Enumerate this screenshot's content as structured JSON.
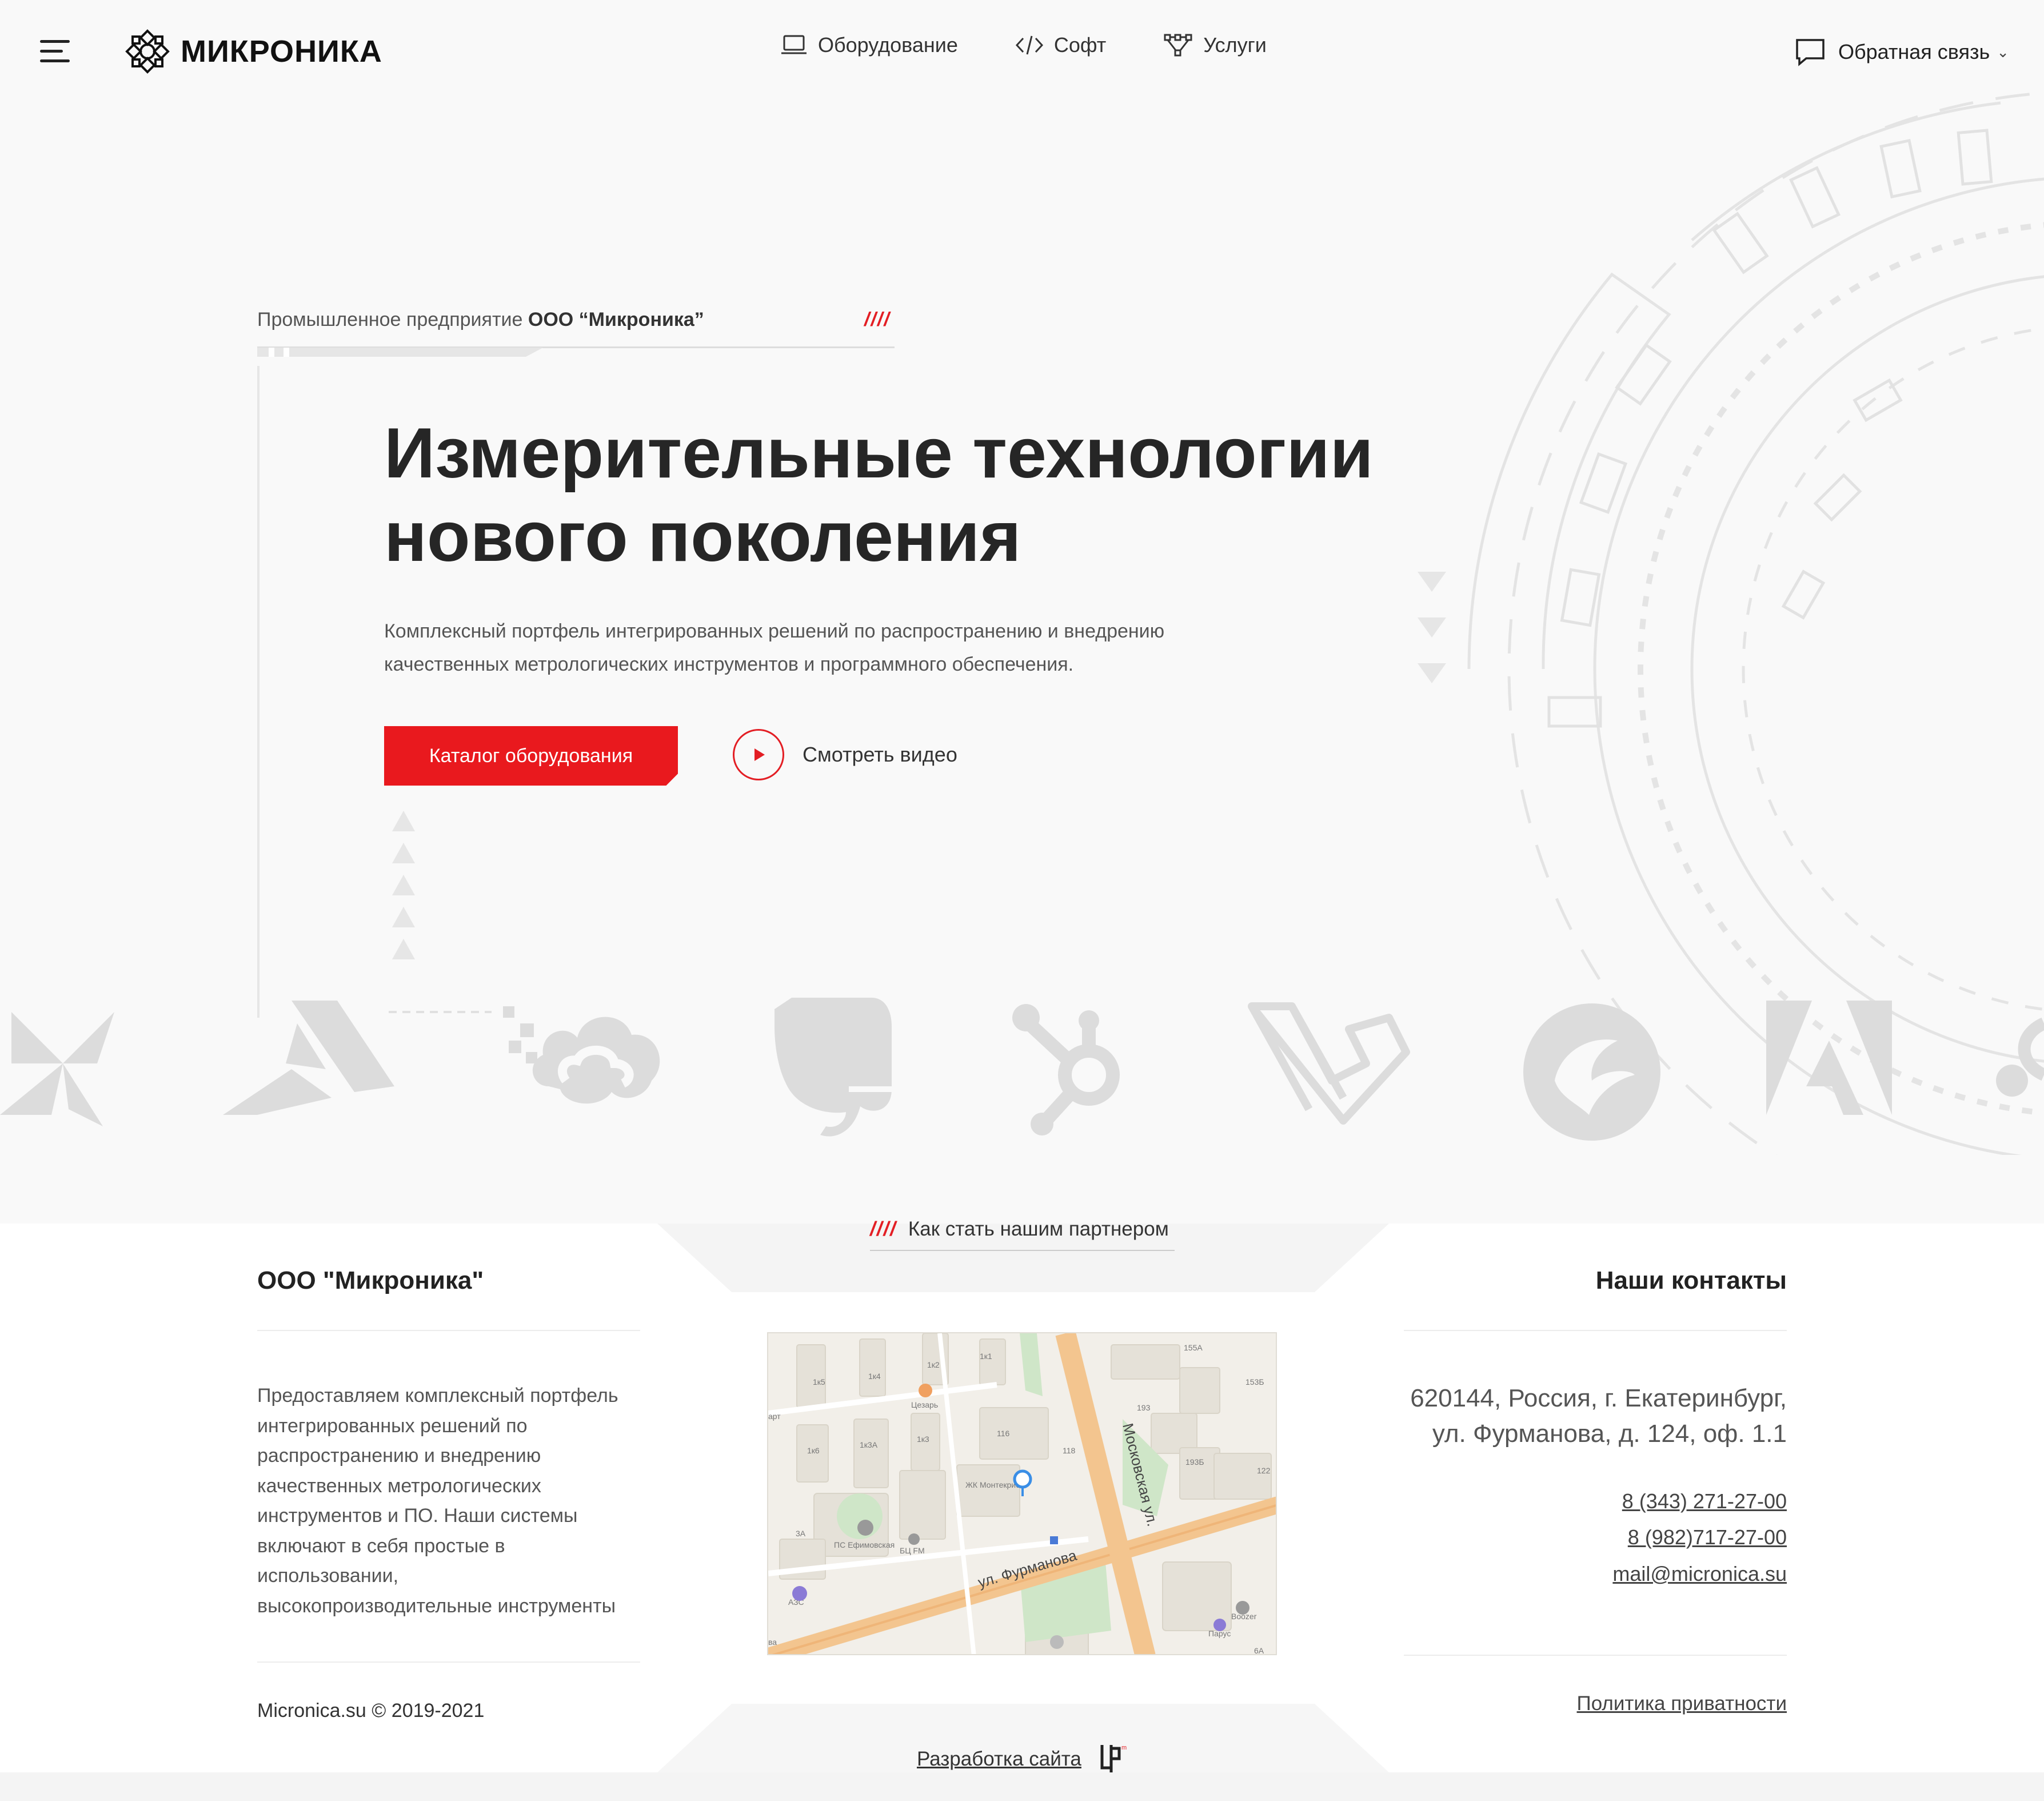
{
  "header": {
    "logo_text": "МИКРОНИКА",
    "nav": [
      {
        "label": "Оборудование",
        "icon": "laptop-icon"
      },
      {
        "label": "Софт",
        "icon": "code-icon"
      },
      {
        "label": "Услуги",
        "icon": "services-icon"
      }
    ],
    "feedback_label": "Обратная связь"
  },
  "hero": {
    "kicker_prefix": "Промышленное предприятие ",
    "kicker_company": "ООО “Микроника”",
    "kicker_slashes": "////",
    "title_line1": "Измерительные технологии",
    "title_line2": "нового поколения",
    "desc_line1": "Комплексный портфель интегрированных решений по распространению и внедрению",
    "desc_line2": "качественных метрологических инструментов и программного обеспечения.",
    "cta_label": "Каталог оборудования",
    "video_label": "Смотреть видео"
  },
  "partner": {
    "slashes": "////",
    "label": "Как стать нашим партнером"
  },
  "footer": {
    "company": "ООО \"Микроника\"",
    "desc_lines": [
      "Предоставляем комплексный портфель",
      "интегрированных решений по",
      "распространению и внедрению",
      "качественных метрологических",
      "инструментов и ПО. Наши системы",
      "включают в себя простые в",
      "использовании,",
      "высокопроизводительные инструменты"
    ],
    "copyright": "Micronica.su © 2019-2021",
    "contacts_title": "Наши контакты",
    "address_line1": "620144, Россия, г. Екатеринбург,",
    "address_line2": "ул. Фурманова, д. 124, оф. 1.1",
    "phone1": "8 (343) 271-27-00",
    "phone2": "8 (982)717-27-00",
    "email": "mail@micronica.su",
    "privacy": "Политика приватности",
    "dev_label": "Разработка сайта"
  },
  "map": {
    "street1": "Московская ул.",
    "street2": "ул. Фурманова",
    "labels": [
      "1к5",
      "1к4",
      "1к2",
      "1к1",
      "155А",
      "153Б",
      "Цезарь",
      "1к6",
      "1к3А",
      "1к3",
      "116",
      "118",
      "193",
      "193Б",
      "122",
      "ЖК Монтекристо",
      "3А",
      "ПС Ефимовская",
      "БЦ FM",
      "АЗС",
      "Boozer",
      "Парус",
      "6А",
      "арт",
      "ва"
    ]
  },
  "colors": {
    "accent": "#e9191e",
    "text": "#222222",
    "muted": "#555555"
  }
}
